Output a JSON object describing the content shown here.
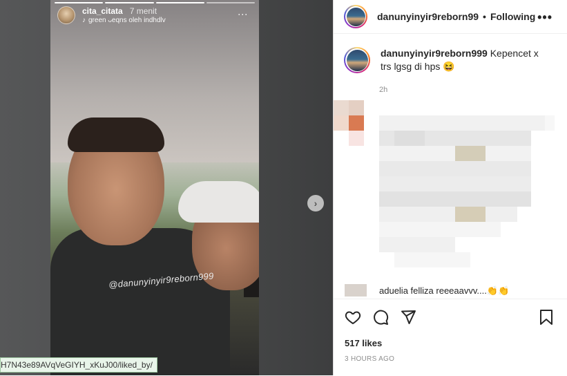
{
  "story": {
    "username": "cita_citata",
    "time": "7 menit",
    "music": "green ᴗeqns oleh indhdlv",
    "shirt_text": "@danunyinyir9reborn999",
    "more": "⋮"
  },
  "next_label": "›",
  "status_url": "H7N43e89AVqVeGIYH_xKuJ00/liked_by/",
  "post": {
    "header_user": "danunyinyir9reborn99",
    "following": "Following",
    "more": "•••",
    "caption_user": "danunyinyir9reborn999",
    "caption_text": " Kepencet x trs lgsg di hps 😆",
    "caption_time": "2h",
    "comment_peek": "aduelia felliza reeeaavvv....👏👏",
    "likes": "517 likes",
    "ago": "3 HOURS AGO"
  },
  "colors": {
    "accent": "#0095f6",
    "text": "#262626",
    "muted": "#8e8e8e"
  }
}
